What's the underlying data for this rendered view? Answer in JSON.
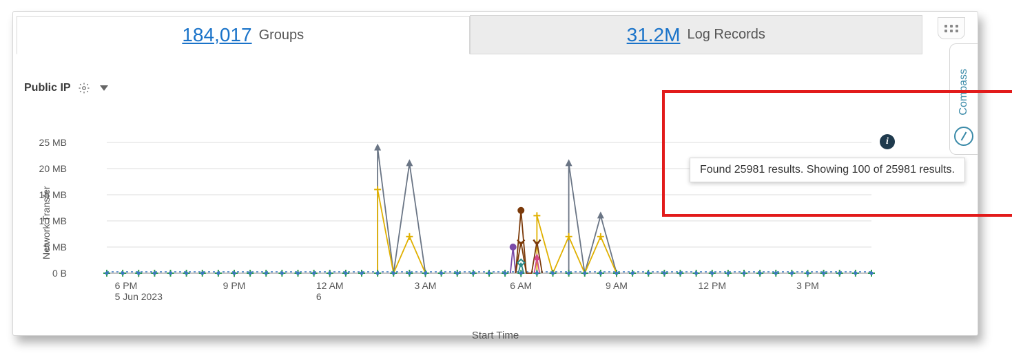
{
  "tabs": {
    "groups": {
      "count": "184,017",
      "label": "Groups",
      "active": true
    },
    "logs": {
      "count": "31.2M",
      "label": "Log Records",
      "active": false
    }
  },
  "header": {
    "title": "Public IP"
  },
  "compass": {
    "label": "Compass"
  },
  "info_icon": "i",
  "tooltip": "Found 25981 results. Showing 100 of 25981 results.",
  "chart_data": {
    "type": "line",
    "xlabel": "Start Time",
    "ylabel": "Network Transfer",
    "ylim": [
      0,
      25
    ],
    "y_unit": "MB",
    "y_ticks": [
      {
        "v": 0,
        "label": "0 B"
      },
      {
        "v": 5,
        "label": "5 MB"
      },
      {
        "v": 10,
        "label": "10 MB"
      },
      {
        "v": 15,
        "label": "15 MB"
      },
      {
        "v": 20,
        "label": "20 MB"
      },
      {
        "v": 25,
        "label": "25 MB"
      }
    ],
    "x_ticks": [
      {
        "label": "6 PM",
        "sub": "5 Jun 2023"
      },
      {
        "label": "9 PM"
      },
      {
        "label": "12 AM",
        "sub": "6"
      },
      {
        "label": "3 AM"
      },
      {
        "label": "6 AM"
      },
      {
        "label": "9 AM"
      },
      {
        "label": "12 PM"
      },
      {
        "label": "3 PM"
      }
    ],
    "series": [
      {
        "name": "grey-triangle",
        "marker": "triangle",
        "color": "#6a7585",
        "points": [
          {
            "t": "1:30 AM",
            "v": 24
          },
          {
            "t": "2:00 AM",
            "v": 0
          },
          {
            "t": "2:30 AM",
            "v": 21
          },
          {
            "t": "3:00 AM",
            "v": 0
          },
          {
            "t": "7:30 AM",
            "v": 21
          },
          {
            "t": "8:00 AM",
            "v": 0
          },
          {
            "t": "8:30 AM",
            "v": 11
          },
          {
            "t": "9:00 AM",
            "v": 0
          }
        ]
      },
      {
        "name": "yellow-plus",
        "marker": "plus",
        "color": "#e0b000",
        "points": [
          {
            "t": "1:30 AM",
            "v": 16
          },
          {
            "t": "2:00 AM",
            "v": 0
          },
          {
            "t": "2:30 AM",
            "v": 7
          },
          {
            "t": "3:00 AM",
            "v": 0
          },
          {
            "t": "6:30 AM",
            "v": 11
          },
          {
            "t": "7:00 AM",
            "v": 0
          },
          {
            "t": "7:30 AM",
            "v": 7
          },
          {
            "t": "8:00 AM",
            "v": 0
          },
          {
            "t": "8:30 AM",
            "v": 7
          },
          {
            "t": "9:00 AM",
            "v": 0
          }
        ]
      },
      {
        "name": "green-plus",
        "marker": "plus",
        "color": "#2e9d4d",
        "baseline": true
      },
      {
        "name": "blue-dot",
        "marker": "dot",
        "color": "#3a78c0",
        "baseline": true,
        "dashed": true
      },
      {
        "name": "purple-circle",
        "marker": "circle",
        "color": "#7a4aa8",
        "points": [
          {
            "t": "5:40 AM",
            "v": 0
          },
          {
            "t": "5:45 AM",
            "v": 5
          },
          {
            "t": "5:50 AM",
            "v": 0
          }
        ]
      },
      {
        "name": "maroon-circle",
        "marker": "circle",
        "color": "#7b3a0a",
        "points": [
          {
            "t": "5:50 AM",
            "v": 0
          },
          {
            "t": "6:00 AM",
            "v": 12
          },
          {
            "t": "6:10 AM",
            "v": 0
          }
        ]
      },
      {
        "name": "maroon-chevron",
        "marker": "chevron-down",
        "color": "#7b3a0a",
        "points": [
          {
            "t": "5:50 AM",
            "v": 0
          },
          {
            "t": "6:00 AM",
            "v": 6
          },
          {
            "t": "6:10 AM",
            "v": 0
          },
          {
            "t": "6:20 AM",
            "v": 0
          },
          {
            "t": "6:30 AM",
            "v": 6
          },
          {
            "t": "6:40 AM",
            "v": 0
          }
        ]
      },
      {
        "name": "teal-diamond",
        "marker": "diamond",
        "color": "#2a8a8a",
        "points": [
          {
            "t": "5:55 AM",
            "v": 0
          },
          {
            "t": "6:00 AM",
            "v": 2
          },
          {
            "t": "6:05 AM",
            "v": 0
          }
        ]
      },
      {
        "name": "pink-triangle",
        "marker": "triangle",
        "color": "#d34a8a",
        "points": [
          {
            "t": "6:25 AM",
            "v": 0
          },
          {
            "t": "6:30 AM",
            "v": 3
          },
          {
            "t": "6:35 AM",
            "v": 0
          }
        ]
      }
    ]
  }
}
